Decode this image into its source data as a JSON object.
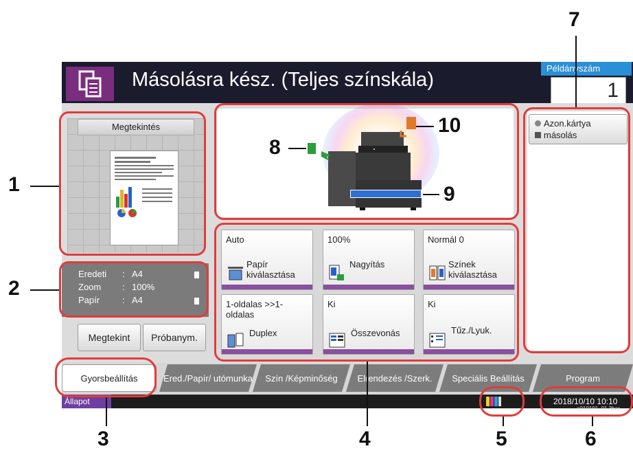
{
  "header": {
    "title": "Másolásra kész. (Teljes színskála)",
    "copies_label": "Példányszám",
    "copies_value": "1"
  },
  "preview": {
    "button_label": "Megtekintés"
  },
  "info": {
    "rows": [
      {
        "key": "Eredeti",
        "sep": ":",
        "value": "A4"
      },
      {
        "key": "Zoom",
        "sep": ":",
        "value": "100%"
      },
      {
        "key": "Papír",
        "sep": ":",
        "value": "A4"
      }
    ]
  },
  "buttons": {
    "preview": "Megtekint",
    "sample": "Próbanym."
  },
  "functions": [
    {
      "value": "Auto",
      "label": "Papír kiválasztása",
      "icon": "paper-tray-icon"
    },
    {
      "value": "100%",
      "label": "Nagyítás",
      "icon": "zoom-icon"
    },
    {
      "value": "Normál 0",
      "label": "Színek kiválasztása",
      "icon": "color-select-icon"
    },
    {
      "value": "1-oldalas >>1-oldalas",
      "label": "Duplex",
      "icon": "duplex-icon"
    },
    {
      "value": "Ki",
      "label": "Összevonás",
      "icon": "combine-icon"
    },
    {
      "value": "Ki",
      "label": "Tűz./Lyuk.",
      "icon": "staple-punch-icon"
    }
  ],
  "right_panel": {
    "id_card_line1": "Azon.kártya",
    "id_card_line2": "másolás"
  },
  "tabs": [
    {
      "label": "Gyorsbeállítás",
      "active": true
    },
    {
      "label": "Ered./Papír/ utómunka",
      "active": false
    },
    {
      "label": "Szín /Képminőség",
      "active": false
    },
    {
      "label": "Elrendezés /Szerk.",
      "active": false
    },
    {
      "label": "Speciális Beállítás",
      "active": false
    },
    {
      "label": "Program",
      "active": false
    }
  ],
  "status": {
    "label": "Állapot",
    "datetime": "2018/10/10  10:10",
    "build": "e010101_01.3bar"
  },
  "callouts": [
    "1",
    "2",
    "3",
    "4",
    "5",
    "6",
    "7",
    "8",
    "9",
    "10"
  ],
  "colors": {
    "header_bg": "#1b1b2e",
    "app_icon_bg": "#7a2d7e",
    "accent_blue": "#2a8fd6",
    "function_bar": "#8a4f9e",
    "callout_ring": "#e03c3c"
  }
}
